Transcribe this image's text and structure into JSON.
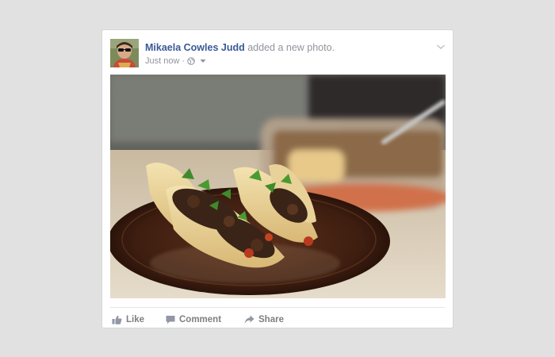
{
  "post": {
    "author": "Mikaela Cowles Judd",
    "action": "added a new photo.",
    "timestamp": "Just now",
    "separator": "·",
    "audience_icon": "globe-icon",
    "audience_dropdown_icon": "caret-down-icon",
    "options_icon": "chevron-down-icon",
    "photo_alt": "photo"
  },
  "actions": {
    "like_label": "Like",
    "comment_label": "Comment",
    "share_label": "Share",
    "like_icon": "thumbs-up-icon",
    "comment_icon": "speech-bubble-icon",
    "share_icon": "share-arrow-icon"
  },
  "colors": {
    "page_background": "#e1e1e1",
    "card_background": "#ffffff",
    "author_link": "#3b5998",
    "secondary_text": "#90949c",
    "action_text": "#7f7f7f"
  }
}
